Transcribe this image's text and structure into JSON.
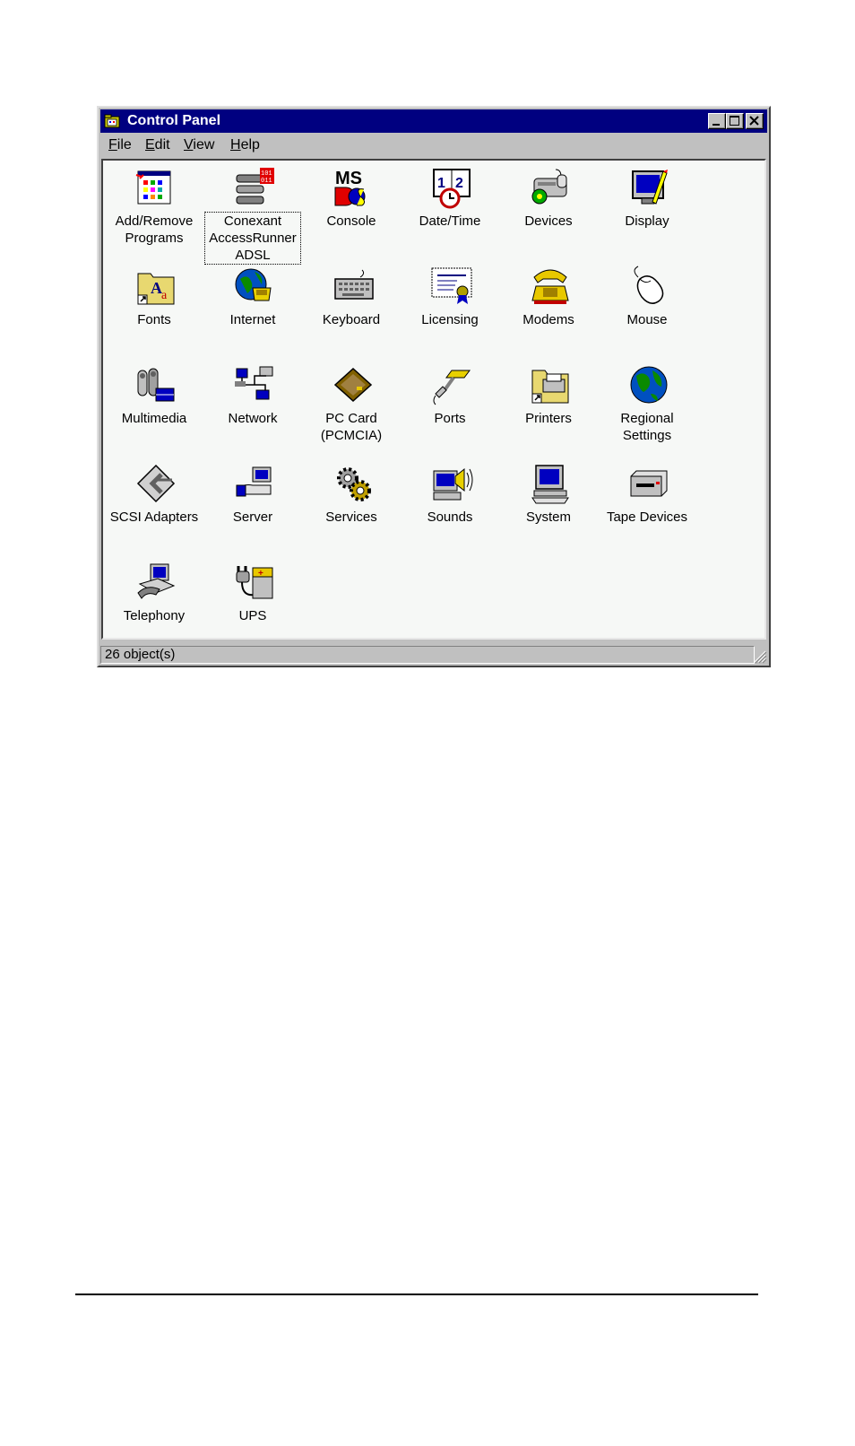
{
  "window": {
    "title": "Control Panel",
    "title_color": "#000080"
  },
  "menu": [
    {
      "key": "F",
      "rest": "ile"
    },
    {
      "key": "E",
      "rest": "dit"
    },
    {
      "key": "V",
      "rest": "iew"
    },
    {
      "key": "H",
      "rest": "elp"
    }
  ],
  "items": [
    {
      "label": "Add/Remove Programs",
      "icon": "add-remove-programs-icon"
    },
    {
      "label": "Conexant AccessRunner ADSL",
      "icon": "conexant-adsl-icon",
      "selected": true
    },
    {
      "label": "Console",
      "icon": "ms-dos-console-icon"
    },
    {
      "label": "Date/Time",
      "icon": "date-time-icon"
    },
    {
      "label": "Devices",
      "icon": "devices-icon"
    },
    {
      "label": "Display",
      "icon": "display-icon"
    },
    {
      "label": "Fonts",
      "icon": "fonts-folder-icon"
    },
    {
      "label": "Internet",
      "icon": "internet-icon"
    },
    {
      "label": "Keyboard",
      "icon": "keyboard-icon"
    },
    {
      "label": "Licensing",
      "icon": "licensing-certificate-icon"
    },
    {
      "label": "Modems",
      "icon": "modem-phone-icon"
    },
    {
      "label": "Mouse",
      "icon": "mouse-icon"
    },
    {
      "label": "Multimedia",
      "icon": "multimedia-icon"
    },
    {
      "label": "Network",
      "icon": "network-icon"
    },
    {
      "label": "PC Card (PCMCIA)",
      "icon": "pc-card-icon"
    },
    {
      "label": "Ports",
      "icon": "ports-icon"
    },
    {
      "label": "Printers",
      "icon": "printers-folder-icon"
    },
    {
      "label": "Regional Settings",
      "icon": "globe-icon"
    },
    {
      "label": "SCSI Adapters",
      "icon": "scsi-icon"
    },
    {
      "label": "Server",
      "icon": "server-icon"
    },
    {
      "label": "Services",
      "icon": "services-gears-icon"
    },
    {
      "label": "Sounds",
      "icon": "sounds-speaker-icon"
    },
    {
      "label": "System",
      "icon": "system-computer-icon"
    },
    {
      "label": "Tape Devices",
      "icon": "tape-drive-icon"
    },
    {
      "label": "Telephony",
      "icon": "telephony-icon"
    },
    {
      "label": "UPS",
      "icon": "ups-battery-icon"
    }
  ],
  "status": {
    "text": "26 object(s)"
  }
}
